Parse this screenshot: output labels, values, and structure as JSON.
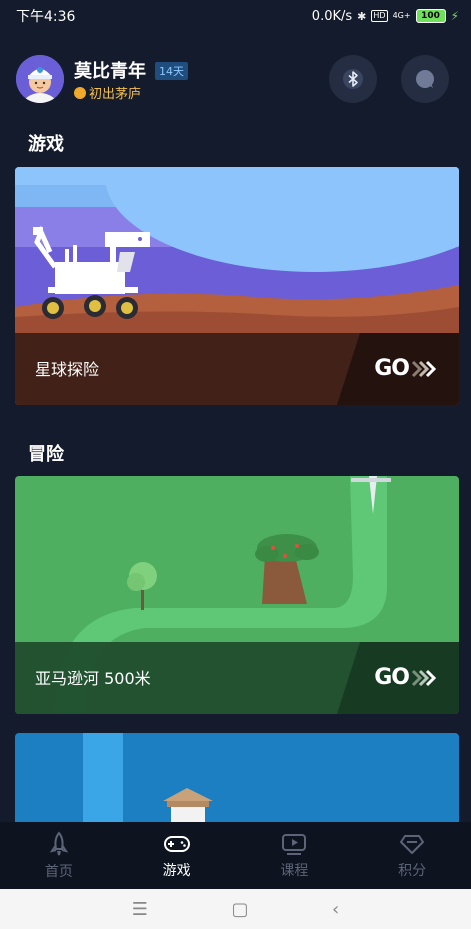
{
  "status_bar": {
    "time": "下午4:36",
    "net_speed": "0.0K/s",
    "hd": "HD",
    "signal": "4G+",
    "battery": "100"
  },
  "profile": {
    "username": "莫比青年",
    "days_badge": "14天",
    "level": "初出茅庐"
  },
  "sections": {
    "games_title": "游戏",
    "adventure_title": "冒险"
  },
  "cards": {
    "planet": {
      "title": "星球探险",
      "go": "GO"
    },
    "amazon": {
      "title": "亚马逊河  500米",
      "go": "GO"
    }
  },
  "nav": {
    "items": [
      {
        "label": "首页",
        "icon": "rocket-icon"
      },
      {
        "label": "游戏",
        "icon": "gamepad-icon"
      },
      {
        "label": "课程",
        "icon": "video-icon"
      },
      {
        "label": "积分",
        "icon": "diamond-icon"
      }
    ],
    "active_index": 1
  },
  "colors": {
    "background": "#141b2c",
    "nav_active": "#ffffff",
    "nav_inactive": "#5d6478",
    "level_gold": "#f5c04a"
  }
}
